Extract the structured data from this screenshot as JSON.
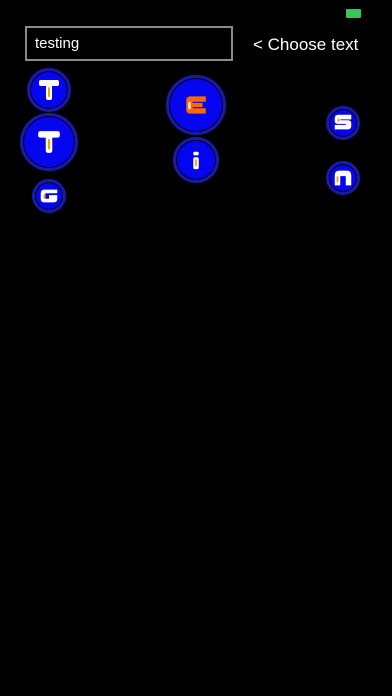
{
  "status_bar": {
    "battery_color": "#35c759"
  },
  "input": {
    "value": "testing"
  },
  "choose_button": {
    "label": "< Choose text"
  },
  "colors": {
    "bubble_fill": "#0505f0",
    "bubble_ring": "#1a1aa8",
    "letter_white": "#ffffff",
    "letter_orange": "#ff6a00",
    "letter_stripe": "#f2a500"
  },
  "bubbles": [
    {
      "letter": "T",
      "color": "white"
    },
    {
      "letter": "T",
      "color": "white"
    },
    {
      "letter": "G",
      "color": "white"
    },
    {
      "letter": "E",
      "color": "orange"
    },
    {
      "letter": "i",
      "color": "white"
    },
    {
      "letter": "S",
      "color": "white"
    },
    {
      "letter": "n",
      "color": "white"
    }
  ]
}
